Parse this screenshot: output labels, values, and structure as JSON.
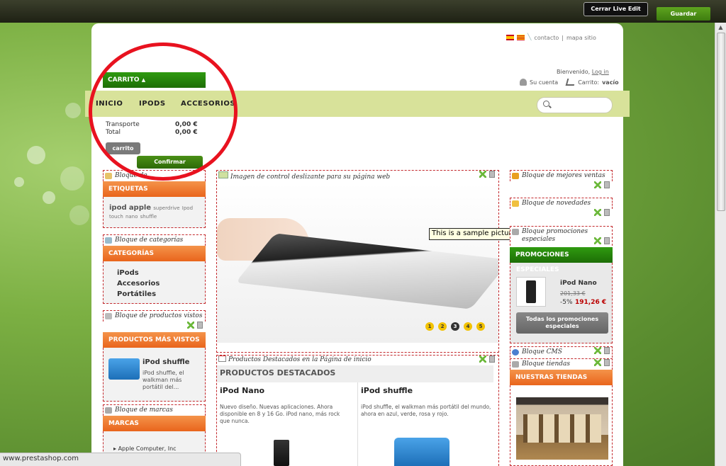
{
  "toolbar": {
    "close_live_edit": "Cerrar Live Edit",
    "save": "Guardar"
  },
  "header": {
    "links": [
      "contacto",
      "|",
      "mapa sitio"
    ],
    "welcome": "Bienvenido,",
    "login": "Log in",
    "account": "Su cuenta",
    "cart_label": "Carrito:",
    "cart_status": "vacío"
  },
  "nav": [
    "INICIO",
    "IPODS",
    "ACCESORIOS"
  ],
  "cart": {
    "title": "CARRITO",
    "rows": [
      {
        "label": "Transporte",
        "value": "0,00 €"
      },
      {
        "label": "Total",
        "value": "0,00 €"
      }
    ],
    "cart_button": "carrito",
    "confirm_button": "Confirmar"
  },
  "left": {
    "tags_module": "Bloque de...",
    "tags_title": "ETIQUETAS",
    "tags": [
      "ipod",
      "apple",
      "superdrive",
      "Ipod",
      "touch",
      "nano",
      "shuffle"
    ],
    "categories_module": "Bloque de categorías",
    "categories_title": "CATEGORÍAS",
    "categories": [
      "iPods",
      "Accesorios",
      "Portátiles"
    ],
    "viewed_module": "Bloque de productos vistos",
    "viewed_title": "PRODUCTOS MÁS VISTOS",
    "viewed_product": "iPod shuffle",
    "viewed_desc": "iPod shuffle, el walkman más portátil del...",
    "brands_module": "Bloque de marcas",
    "brands_title": "MARCAS",
    "brands": [
      "Apple Computer, Inc"
    ]
  },
  "center": {
    "slider_module": "Imagen de control deslizante para su página web",
    "slider_dots": [
      "1",
      "2",
      "3",
      "4",
      "5"
    ],
    "tooltip": "This is a sample picture",
    "featured_module": "Productos Destacados en la Página de inicio",
    "featured_title": "PRODUCTOS DESTACADOS",
    "products": [
      {
        "name": "iPod Nano",
        "desc": "Nuevo diseño. Nuevas aplicaciones. Ahora disponible en 8 y 16 Go. iPod nano, más rock que nunca."
      },
      {
        "name": "iPod shuffle",
        "desc": "iPod shuffle, el walkman más portátil del mundo, ahora en azul, verde, rosa y rojo."
      }
    ]
  },
  "right": {
    "best_module": "Bloque de mejores ventas",
    "new_module": "Bloque de novedades",
    "promo_module": "Bloque promociones especiales",
    "promo_title": "PROMOCIONES",
    "promo_sub": "ESPECIALES",
    "promo_product": "iPod Nano",
    "promo_old": "201,33 €",
    "promo_discount": "-5%",
    "promo_price": "191,26 €",
    "promo_button": "Todas los promociones especiales",
    "cms_module": "Bloque CMS",
    "stores_module": "Bloque tiendas",
    "stores_title": "NUESTRAS TIENDAS"
  },
  "statusbar": "www.prestashop.com",
  "colors": {
    "accent_green": "#2f9a10",
    "accent_orange": "#e9651c",
    "nav_bg": "#d8e29a",
    "highlight_circle": "#e8121f"
  }
}
